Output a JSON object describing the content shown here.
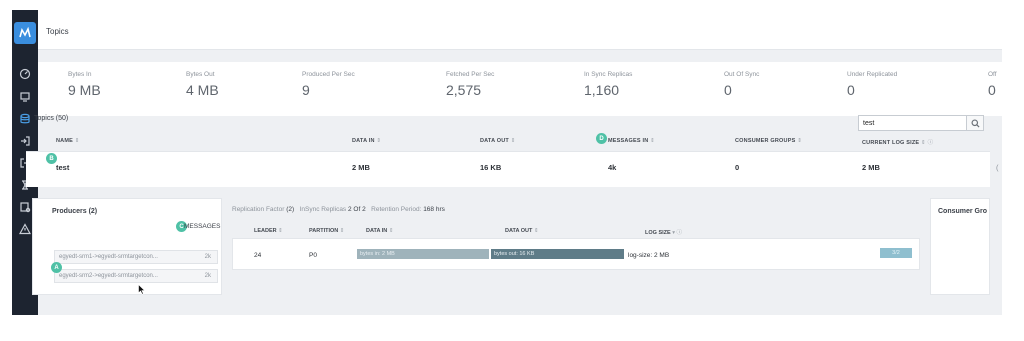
{
  "app": {
    "title": "Topics",
    "accent": "#4fc1a6",
    "brand": "#3a8ede"
  },
  "sidebar": {
    "icons": [
      {
        "name": "dashboard-icon"
      },
      {
        "name": "monitor-icon"
      },
      {
        "name": "database-icon",
        "active": true
      },
      {
        "name": "sign-in-icon"
      },
      {
        "name": "sign-out-icon"
      },
      {
        "name": "hourglass-icon"
      },
      {
        "name": "settings-list-icon"
      },
      {
        "name": "warning-icon"
      }
    ]
  },
  "metrics": [
    {
      "label": "Bytes In",
      "value": "9 MB"
    },
    {
      "label": "Bytes Out",
      "value": "4 MB"
    },
    {
      "label": "Produced Per Sec",
      "value": "9"
    },
    {
      "label": "Fetched Per Sec",
      "value": "2,575"
    },
    {
      "label": "In Sync Replicas",
      "value": "1,160"
    },
    {
      "label": "Out Of Sync",
      "value": "0"
    },
    {
      "label": "Under Replicated",
      "value": "0"
    },
    {
      "label": "Off",
      "value": "0"
    }
  ],
  "topics": {
    "title": "Topics (50)",
    "search_value": "test",
    "columns": [
      "NAME",
      "DATA IN",
      "DATA OUT",
      "MESSAGES IN",
      "CONSUMER GROUPS",
      "CURRENT LOG SIZE"
    ],
    "sort_glyph": "⇕",
    "row": {
      "name": "test",
      "data_in": "2 MB",
      "data_out": "16 KB",
      "messages_in": "4k",
      "consumer_groups": "0",
      "log_size": "2 MB",
      "trailing": "("
    }
  },
  "badges": {
    "a": "A",
    "b": "B",
    "c": "C",
    "d": "D"
  },
  "producers": {
    "title": "Producers (2)",
    "messages_label": "MESSAGES",
    "items": [
      {
        "name": "egyedt-srm1->egyedt-srmtargetcon...",
        "count": "2k"
      },
      {
        "name": "egyedt-srm2->egyedt-srmtargetcon...",
        "count": "2k"
      }
    ]
  },
  "replication": {
    "rf_label": "Replication Factor",
    "rf_value": "(2)",
    "insync_label": "InSync Replicas",
    "insync_value": "2 Of 2",
    "retention_label": "Retention Period:",
    "retention_value": "168 hrs"
  },
  "partitions": {
    "columns": [
      "LEADER",
      "PARTITION",
      "DATA IN",
      "DATA OUT",
      "LOG SIZE"
    ],
    "sort_glyph": "⇕",
    "log_size_suffix": "▾ ⓘ",
    "row": {
      "leader": "24",
      "partition": "P0",
      "bytes_in": "bytes in: 2 MB",
      "bytes_out": "bytes out: 16 KB",
      "log_size": "log-size: 2 MB",
      "action": "3/2"
    }
  },
  "consumer": {
    "title": "Consumer Gro"
  }
}
